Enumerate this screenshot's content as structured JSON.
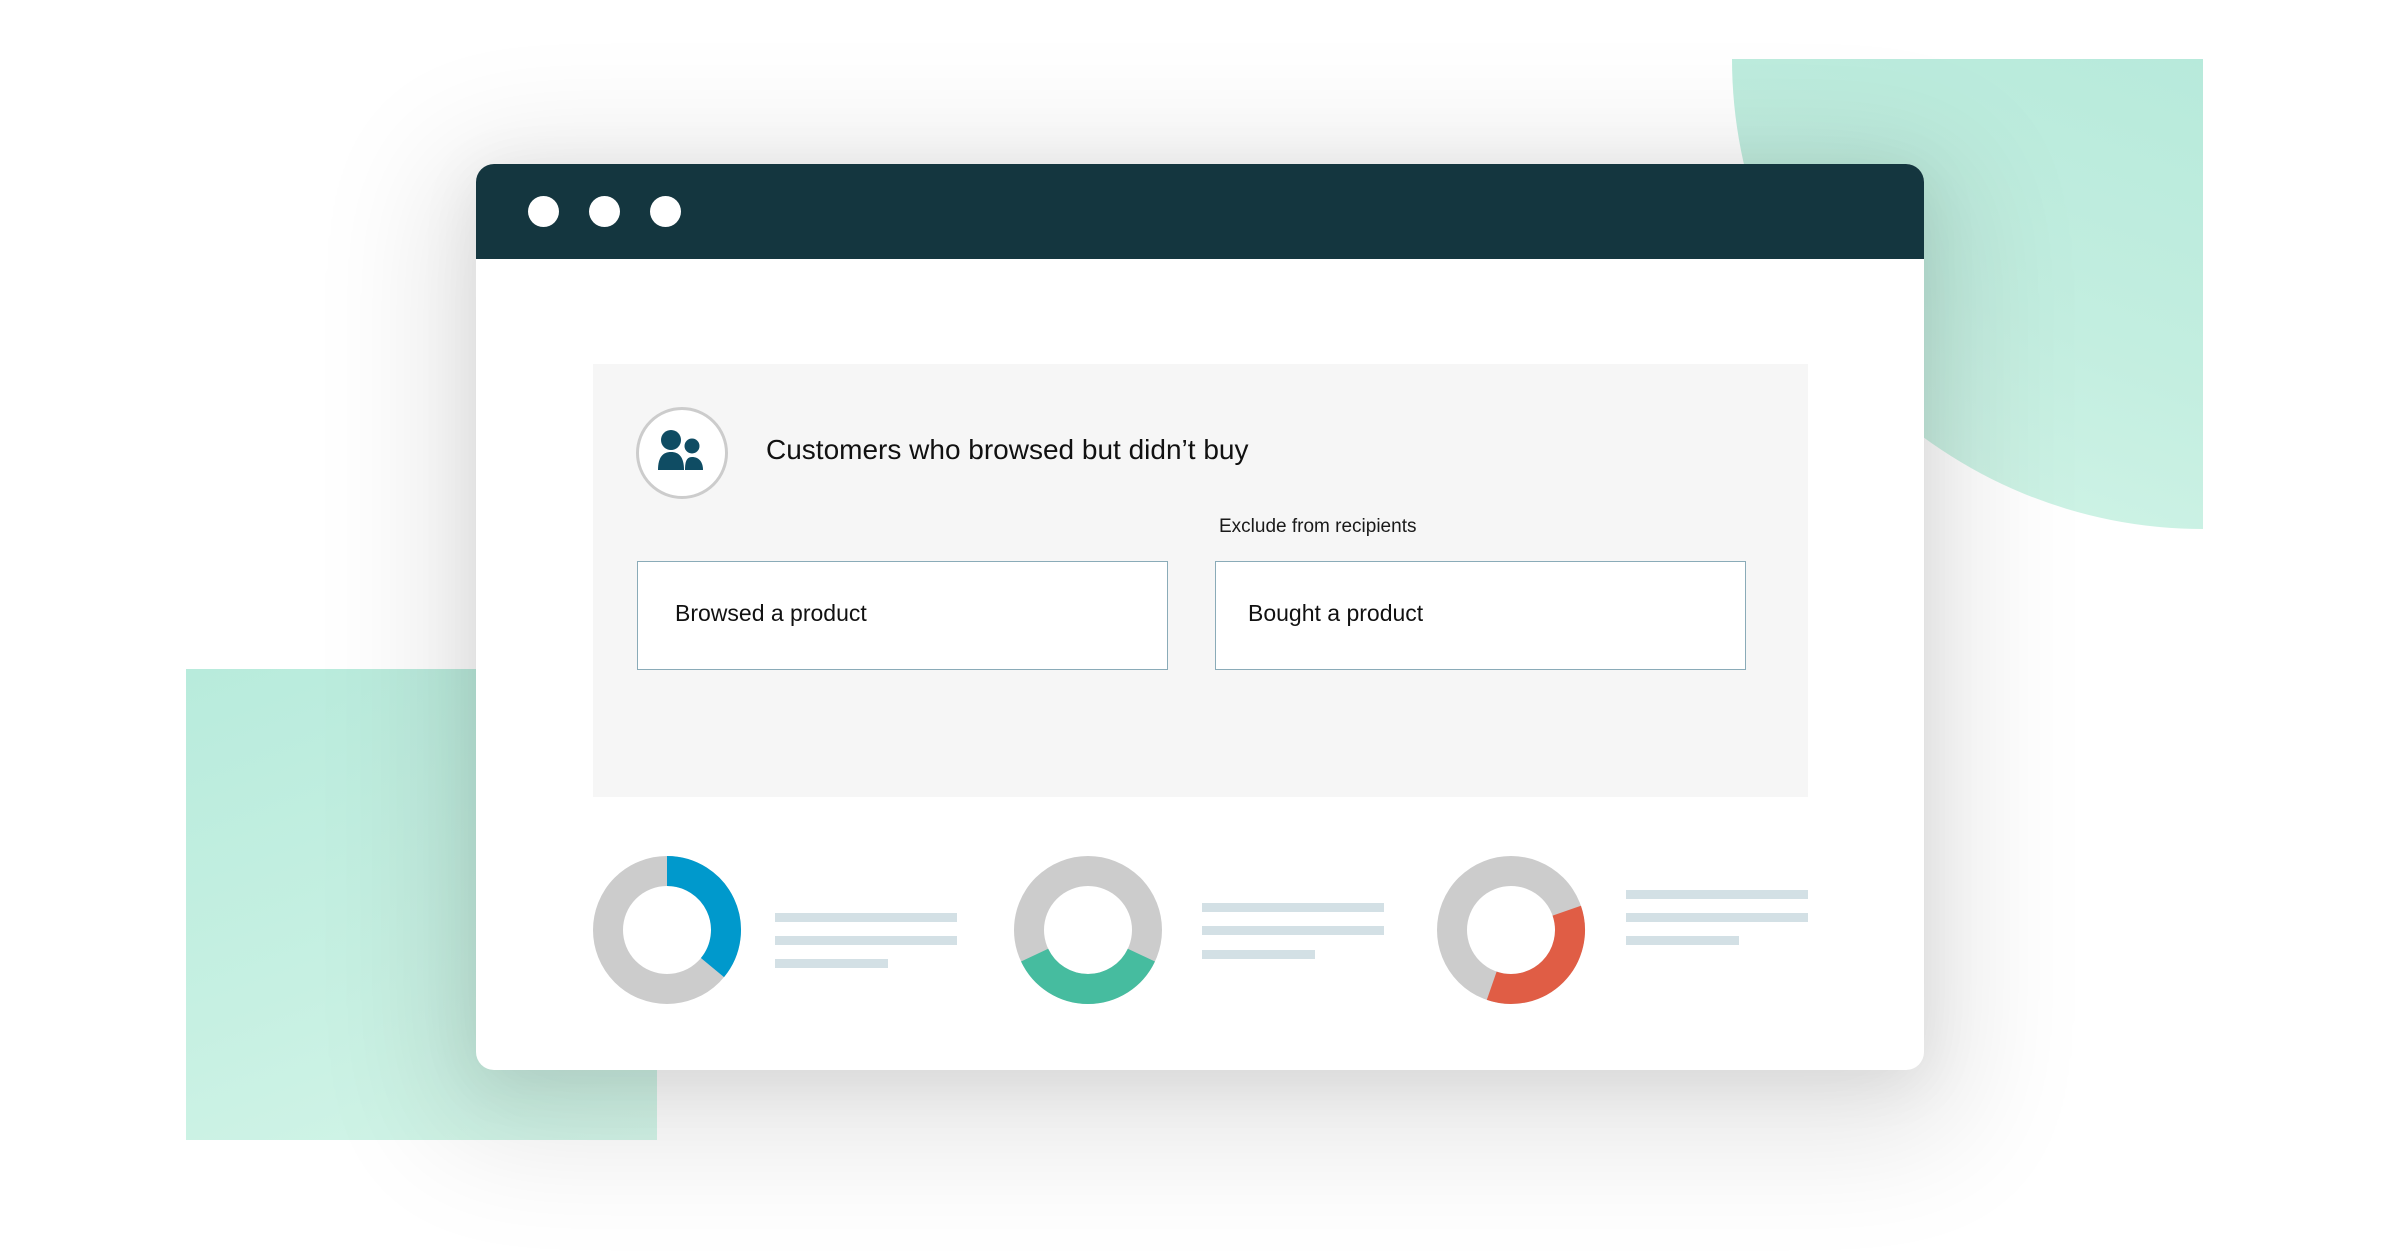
{
  "window": {
    "controls": [
      "window-dot",
      "window-dot",
      "window-dot"
    ]
  },
  "segment": {
    "icon": "users-icon",
    "title": "Customers who browsed but didn’t buy",
    "exclude_label": "Exclude from recipients",
    "include_condition": "Browsed a product",
    "exclude_condition": "Bought a product"
  },
  "colors": {
    "titlebar": "#14363f",
    "accent_icon": "#0f4c63",
    "donut_track": "#cccccc",
    "blue": "#0099cc",
    "green": "#46bc9f",
    "red": "#e05d45",
    "placeholder_line": "#d3e0e5",
    "decor_mint": "#c3eee0"
  },
  "stats": [
    {
      "name": "blue-donut",
      "color": "#0099cc",
      "start_fraction": 0.0,
      "fraction": 0.36
    },
    {
      "name": "green-donut",
      "color": "#46bc9f",
      "start_fraction": 0.32,
      "fraction": 0.36
    },
    {
      "name": "red-donut",
      "color": "#e05d45",
      "start_fraction": 0.197,
      "fraction": 0.356
    }
  ]
}
